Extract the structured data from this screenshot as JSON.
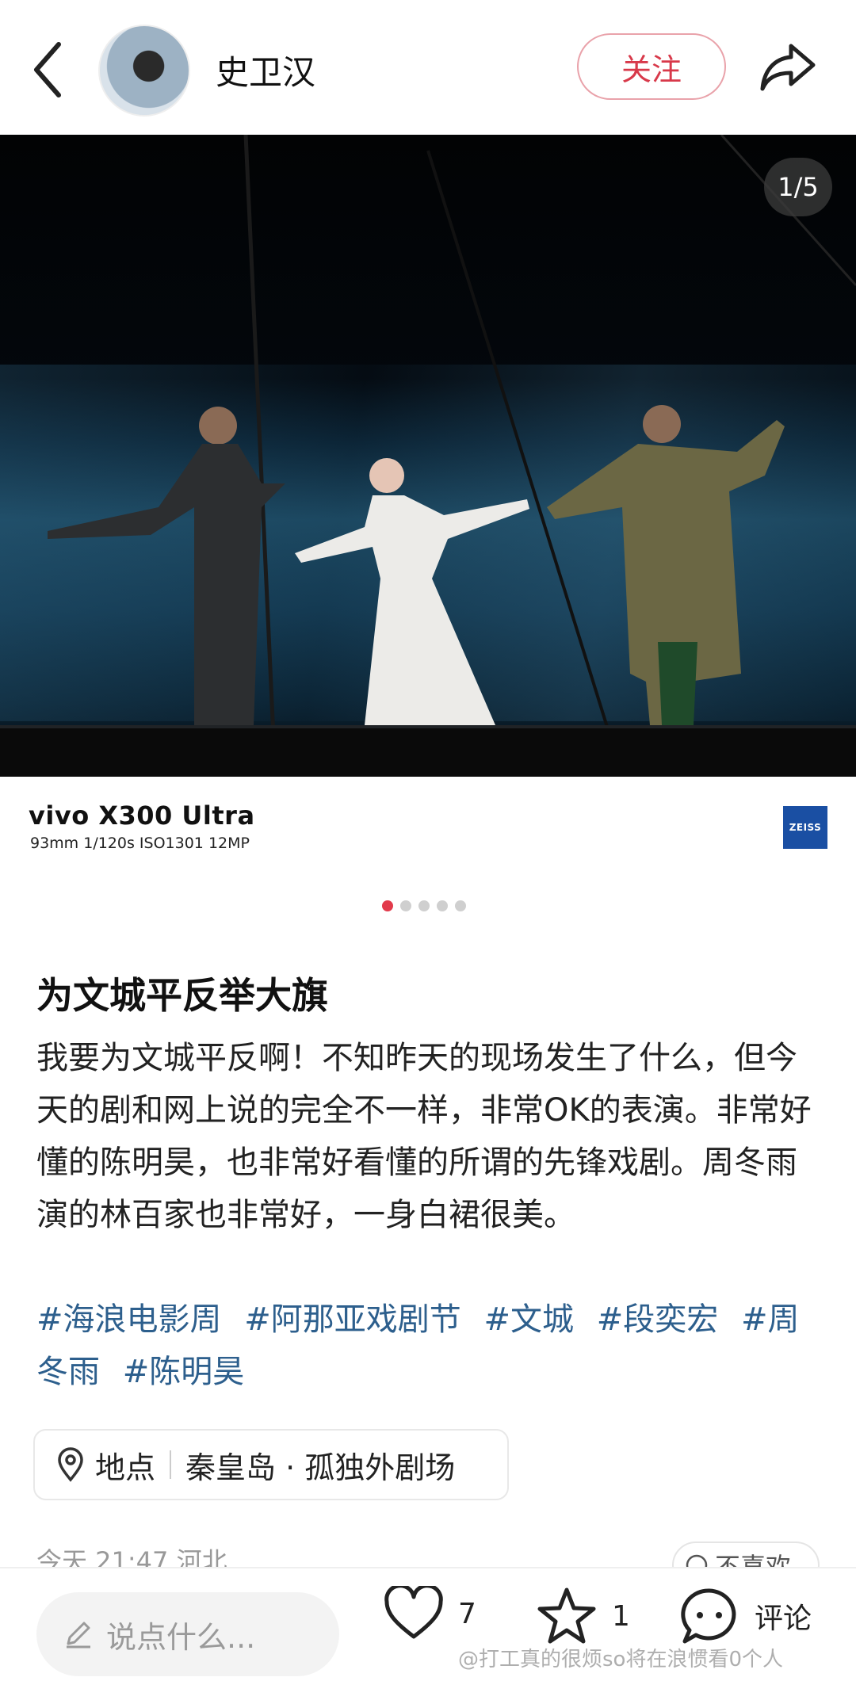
{
  "header": {
    "username": "史卫汉",
    "follow_label": "关注"
  },
  "photo": {
    "pager": "1/5",
    "camera_brand": "vivo X300 Ultra",
    "exif": "93mm  1/120s  ISO1301  12MP",
    "lens_brand": "ZEISS",
    "dots": {
      "count": 5,
      "active_index": 0
    }
  },
  "post": {
    "title": "为文城平反举大旗",
    "body": "我要为文城平反啊！不知昨天的现场发生了什么，但今天的剧和网上说的完全不一样，非常OK的表演。非常好懂的陈明昊，也非常好看懂的所谓的先锋戏剧。周冬雨演的林百家也非常好，一身白裙很美。",
    "tags": [
      "#海浪电影周",
      "#阿那亚戏剧节",
      "#文城",
      "#段奕宏",
      "#周冬雨",
      "#陈明昊"
    ],
    "location_label": "地点",
    "location_value": "秦皇岛 · 孤独外剧场",
    "time": "今天 21:47  河北",
    "dislike_label": "不喜欢"
  },
  "bottom_bar": {
    "input_placeholder": "说点什么...",
    "likes": "7",
    "favorites": "1",
    "comment_label": "评论",
    "watermark": "@打工真的很烦so将在浪惯看0个人"
  },
  "colors": {
    "accent": "#d8394a",
    "hashtag": "#2d5f8d"
  }
}
